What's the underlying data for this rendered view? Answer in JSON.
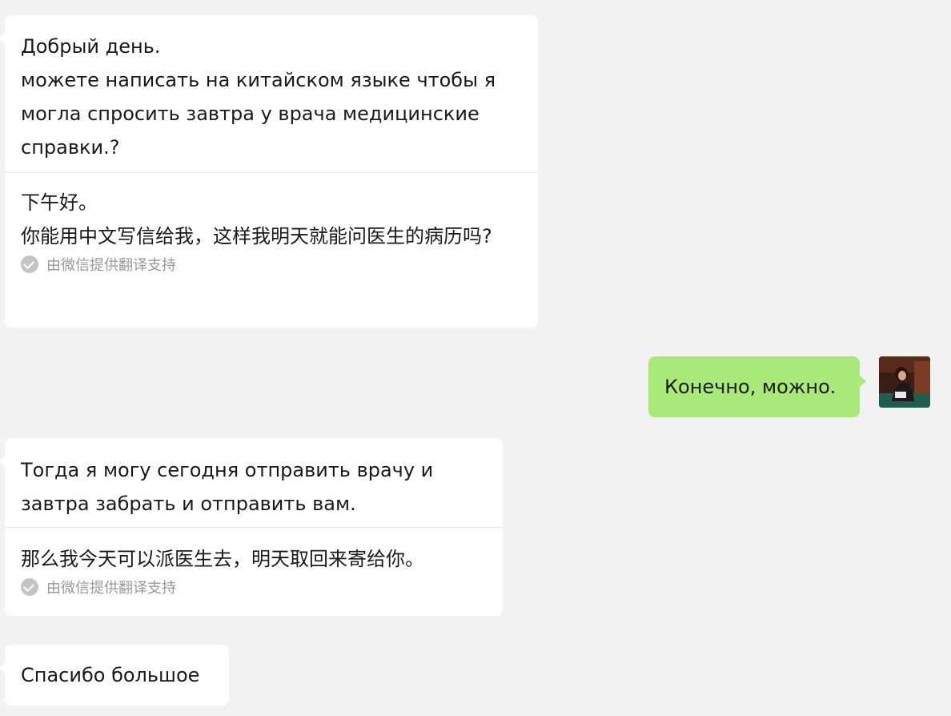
{
  "messages": [
    {
      "original": "Добрый день.\nможете написать на китайском языке чтобы я могла спросить завтра у врача медицинские справки.?",
      "translation": "下午好。\n你能用中文写信给我，这样我明天就能问医生的病历吗?",
      "credit": "由微信提供翻译支持"
    },
    {
      "text": "Конечно, можно."
    },
    {
      "original": "Тогда я могу сегодня отправить врачу и завтра забрать и отправить вам.",
      "translation": "那么我今天可以派医生去，明天取回来寄给你。",
      "credit": "由微信提供翻译支持"
    },
    {
      "text": "Спасибо большое"
    }
  ],
  "icons": {
    "credit": "check-circle-icon",
    "avatar": "user-avatar"
  },
  "colors": {
    "background": "#f2f2f2",
    "incoming_bubble": "#ffffff",
    "outgoing_bubble": "#a9e97a",
    "credit_text": "#9a9a9a"
  }
}
